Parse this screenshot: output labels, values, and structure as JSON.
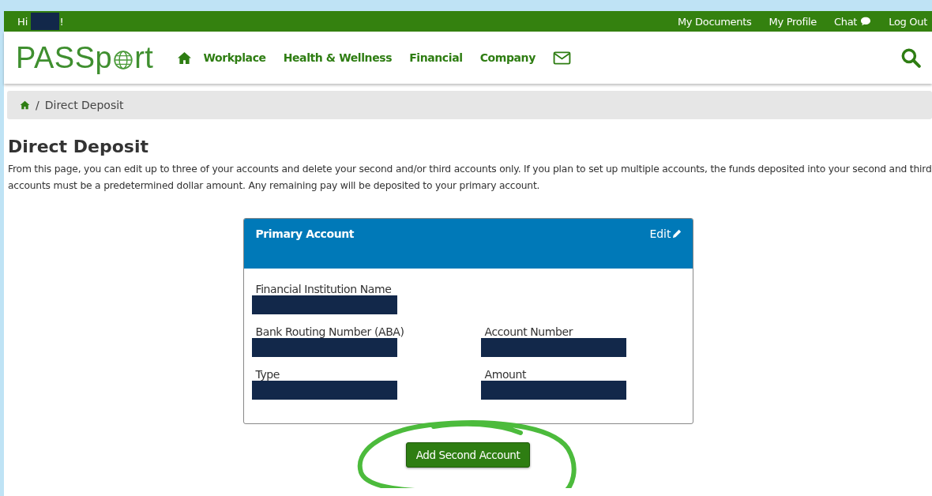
{
  "top_bar": {
    "greeting_start": "Hi",
    "greeting_end": "!",
    "links": [
      {
        "label": "My Documents",
        "kind": "text"
      },
      {
        "label": "My Profile",
        "kind": "text"
      },
      {
        "label": "Chat",
        "kind": "chat"
      },
      {
        "label": "Log Out",
        "kind": "text"
      }
    ]
  },
  "logo": {
    "before": "PASSp",
    "after": "rt"
  },
  "nav": {
    "items": [
      {
        "label": "Workplace"
      },
      {
        "label": "Health & Wellness"
      },
      {
        "label": "Financial"
      },
      {
        "label": "Company"
      }
    ]
  },
  "breadcrumb": {
    "separator": "/",
    "current": "Direct Deposit"
  },
  "page": {
    "title": "Direct Deposit",
    "intro": "From this page, you can edit up to three of your accounts and delete your second and/or third accounts only. If you plan to set up multiple accounts, the funds deposited into your second and third accounts must be a predetermined dollar amount. Any remaining pay will be deposited to your primary account."
  },
  "account_card": {
    "title": "Primary Account",
    "edit": "Edit",
    "fields": [
      {
        "label": "Financial Institution Name",
        "kind": "wide"
      },
      {
        "label": "Bank Routing Number (ABA)",
        "kind": "cell"
      },
      {
        "label": "Account Number",
        "kind": "cell"
      },
      {
        "label": "Type",
        "kind": "cell"
      },
      {
        "label": "Amount",
        "kind": "cell"
      }
    ]
  },
  "add_button": {
    "label": "Add Second Account",
    "highlighted": true
  }
}
